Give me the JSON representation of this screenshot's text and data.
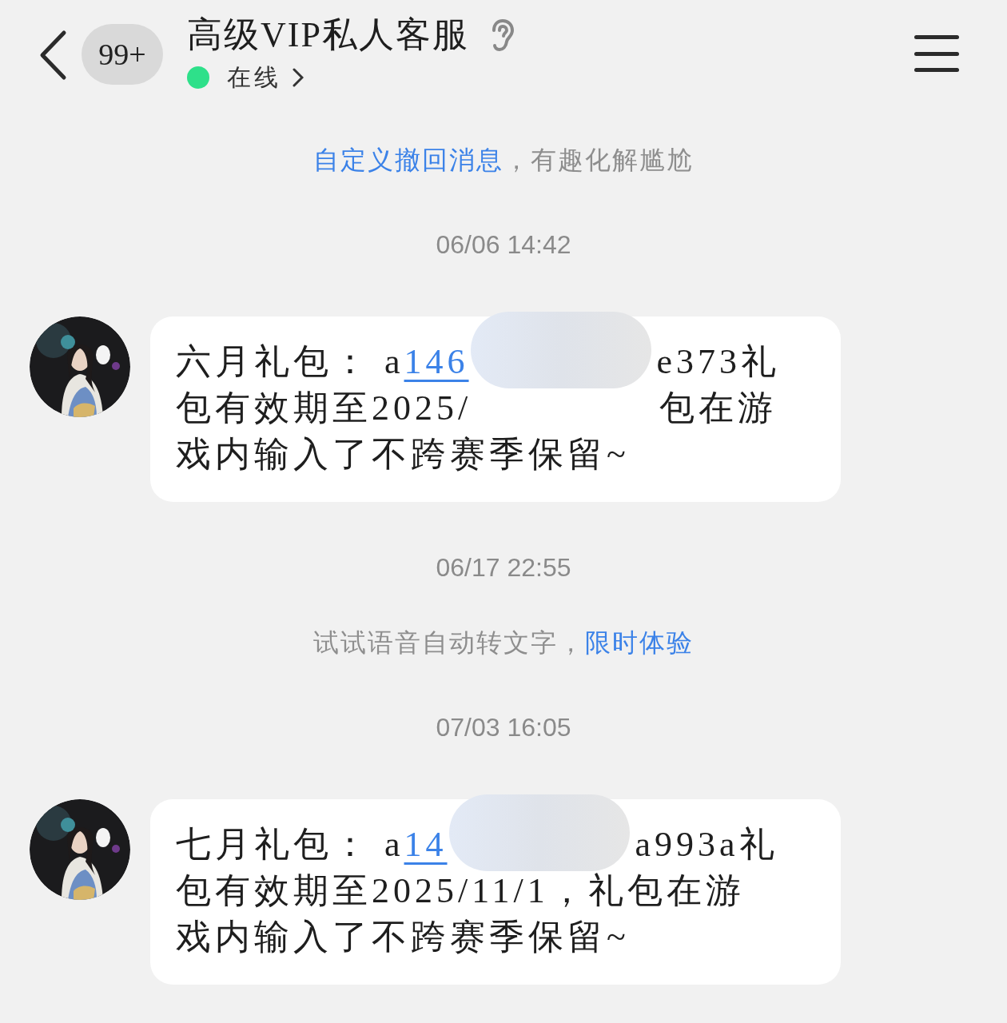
{
  "header": {
    "unread_badge": "99+",
    "title": "高级VIP私人客服",
    "status": {
      "label": "在线",
      "color": "#2ee08a"
    }
  },
  "items": [
    {
      "kind": "notice",
      "parts": [
        {
          "kind": "link",
          "text": "自定义撤回消息"
        },
        {
          "kind": "text",
          "text": "，有趣化解尴尬"
        }
      ]
    },
    {
      "kind": "time",
      "text": "06/06 14:42"
    },
    {
      "kind": "message",
      "lines": [
        [
          {
            "kind": "text",
            "text": "六月礼包： a"
          },
          {
            "kind": "link",
            "text": "146"
          },
          {
            "kind": "blur"
          },
          {
            "kind": "text",
            "text": "e373礼"
          }
        ],
        [
          {
            "kind": "text",
            "text": "包有效期至2025/"
          },
          {
            "kind": "gap"
          },
          {
            "kind": "text",
            "text": "包在游"
          }
        ],
        [
          {
            "kind": "text",
            "text": "戏内输入了不跨赛季保留~"
          }
        ]
      ]
    },
    {
      "kind": "time",
      "text": "06/17 22:55"
    },
    {
      "kind": "notice",
      "parts": [
        {
          "kind": "text",
          "text": "试试语音自动转文字，"
        },
        {
          "kind": "link",
          "text": "限时体验"
        }
      ]
    },
    {
      "kind": "time",
      "text": "07/03 16:05"
    },
    {
      "kind": "message",
      "lines": [
        [
          {
            "kind": "text",
            "text": "七月礼包： a"
          },
          {
            "kind": "link",
            "text": "14"
          },
          {
            "kind": "blur"
          },
          {
            "kind": "text",
            "text": "a993a礼"
          }
        ],
        [
          {
            "kind": "text",
            "text": "包有效期至2025/11/1，礼包在游"
          }
        ],
        [
          {
            "kind": "text",
            "text": "戏内输入了不跨赛季保留~"
          }
        ]
      ]
    }
  ]
}
